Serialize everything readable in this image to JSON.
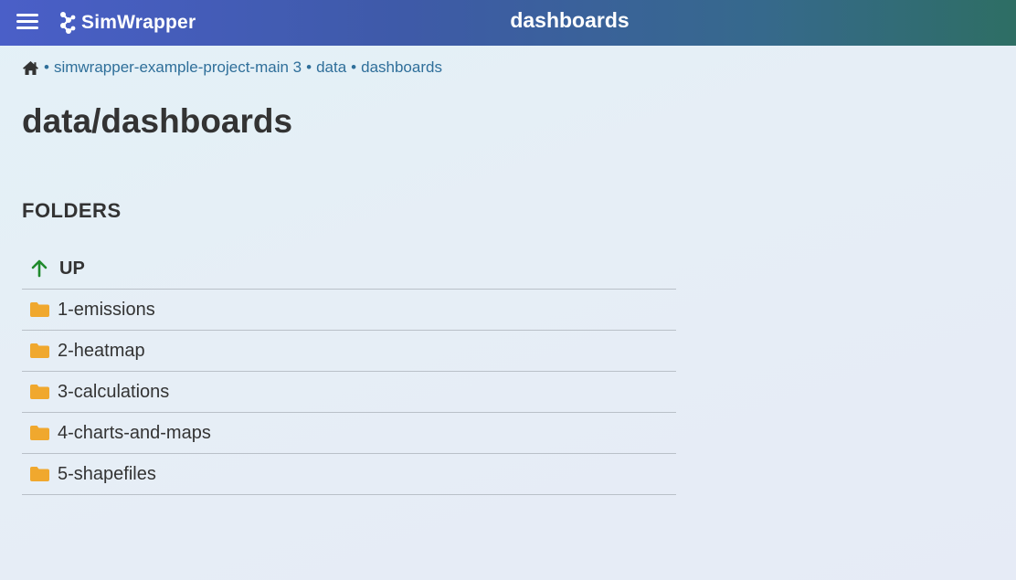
{
  "header": {
    "menu_icon": "hamburger-menu-icon",
    "logo_icon": "simwrapper-logo-icon",
    "app_name": "SimWrapper",
    "title": "dashboards",
    "colors": {
      "gradient_start": "#4a5fc8",
      "gradient_end": "#2e6e64",
      "text": "#ffffff"
    }
  },
  "breadcrumb": {
    "home_icon": "home-icon",
    "separator": "•",
    "items": [
      {
        "label": "simwrapper-example-project-main 3"
      },
      {
        "label": "data"
      },
      {
        "label": "dashboards"
      }
    ],
    "link_color": "#2f6f9a"
  },
  "page": {
    "title": "data/dashboards"
  },
  "folders": {
    "heading": "FOLDERS",
    "up": {
      "label": "UP",
      "icon": "arrow-up-icon",
      "icon_color": "#1f8a2c"
    },
    "items": [
      {
        "label": "1-emissions",
        "icon": "folder-icon"
      },
      {
        "label": "2-heatmap",
        "icon": "folder-icon"
      },
      {
        "label": "3-calculations",
        "icon": "folder-icon"
      },
      {
        "label": "4-charts-and-maps",
        "icon": "folder-icon"
      },
      {
        "label": "5-shapefiles",
        "icon": "folder-icon"
      }
    ],
    "folder_icon_color": "#f0a82e"
  }
}
